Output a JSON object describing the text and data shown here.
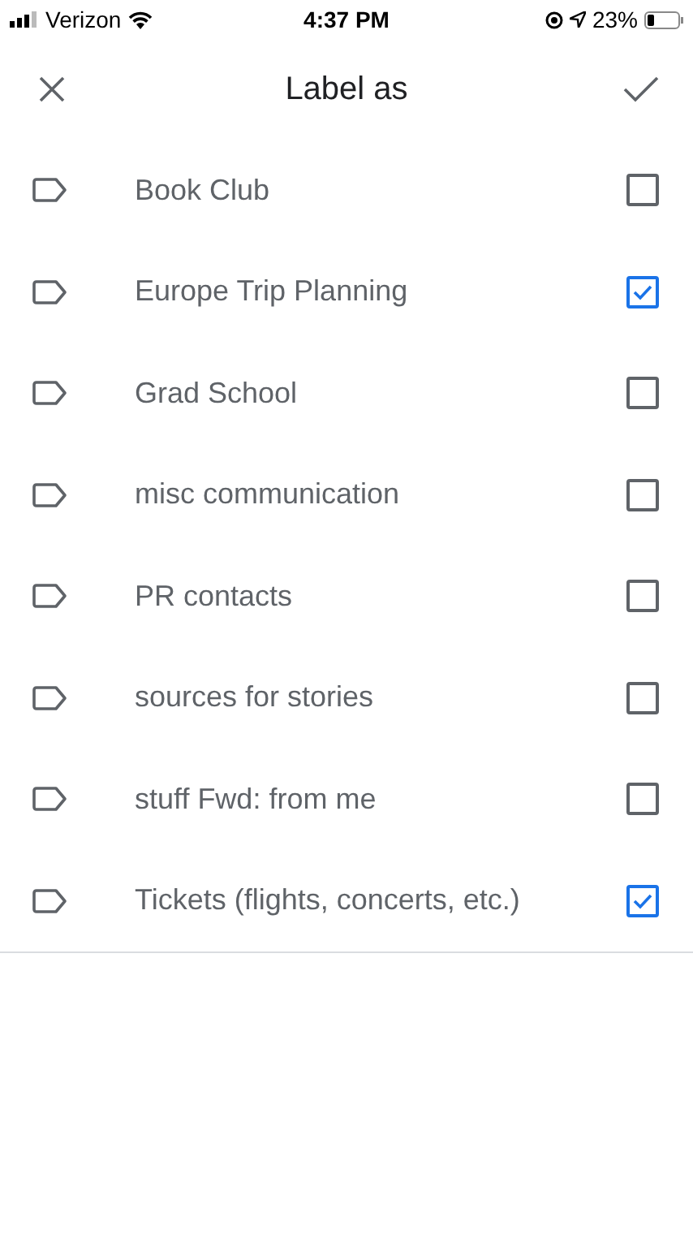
{
  "status_bar": {
    "carrier": "Verizon",
    "time": "4:37 PM",
    "battery": "23%"
  },
  "header": {
    "title": "Label as"
  },
  "labels": [
    {
      "name": "Book Club",
      "checked": false
    },
    {
      "name": "Europe Trip Planning",
      "checked": true
    },
    {
      "name": "Grad School",
      "checked": false
    },
    {
      "name": "misc communication",
      "checked": false
    },
    {
      "name": "PR contacts",
      "checked": false
    },
    {
      "name": "sources for stories",
      "checked": false
    },
    {
      "name": "stuff Fwd: from me",
      "checked": false
    },
    {
      "name": "Tickets (flights, concerts, etc.)",
      "checked": true
    }
  ]
}
